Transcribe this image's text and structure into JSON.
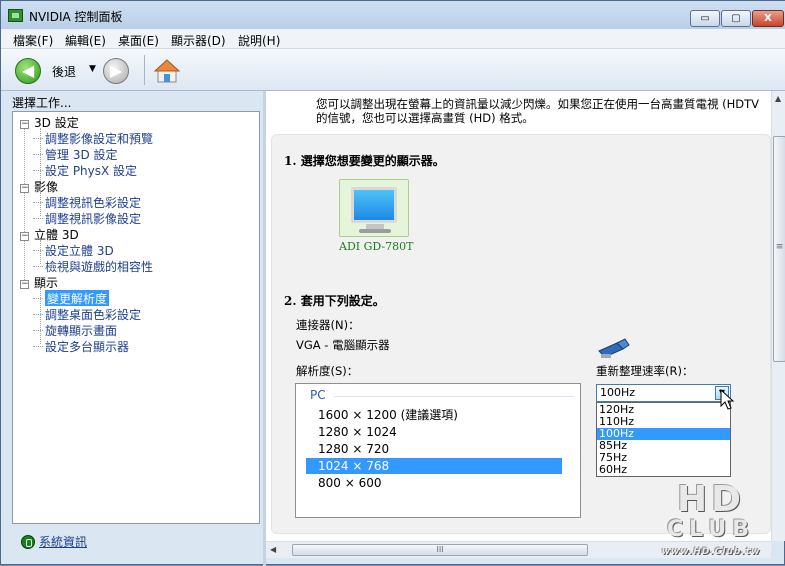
{
  "window": {
    "title": "NVIDIA 控制面板",
    "controls": {
      "minimize": "▭",
      "maximize": "▢",
      "close": "X"
    }
  },
  "menu": [
    "檔案(F)",
    "編輯(E)",
    "桌面(E)",
    "顯示器(D)",
    "說明(H)"
  ],
  "toolbar": {
    "back_label": "後退",
    "back_icon": "back-arrow-icon",
    "forward_icon": "forward-arrow-icon",
    "home_icon": "home-icon"
  },
  "sidebar": {
    "header": "選擇工作...",
    "categories": [
      {
        "label": "3D 設定",
        "items": [
          "調整影像設定和預覽",
          "管理 3D 設定",
          "設定 PhysX 設定"
        ]
      },
      {
        "label": "影像",
        "items": [
          "調整視訊色彩設定",
          "調整視訊影像設定"
        ]
      },
      {
        "label": "立體 3D",
        "items": [
          "設定立體 3D",
          "檢視與遊戲的相容性"
        ]
      },
      {
        "label": "顯示",
        "items": [
          "變更解析度",
          "調整桌面色彩設定",
          "旋轉顯示畫面",
          "設定多台顯示器"
        ]
      }
    ],
    "selected_item": "變更解析度",
    "collapse_glyph": "−",
    "system_info_link": "系統資訊"
  },
  "content": {
    "intro_line1": "您可以調整出現在螢幕上的資訊量以減少閃爍。如果您正在使用一台高畫質電視 (HDTV",
    "intro_line2": "的信號，您也可以選擇高畫質 (HD) 格式。",
    "section1_title": "1. 選擇您想要變更的顯示器。",
    "monitor_name": "ADI GD-780T",
    "section2_title": "2. 套用下列設定。",
    "connector_label": "連接器(N)：",
    "connector_value": "VGA - 電腦顯示器",
    "resolution_label": "解析度(S)：",
    "resolution_group": "PC",
    "resolutions": [
      "1600 × 1200  (建議選項)",
      "1280 × 1024",
      "1280 × 720",
      "1024 × 768",
      "800 × 600"
    ],
    "selected_resolution": "1024 × 768",
    "refresh_label": "重新整理速率(R)：",
    "refresh_value": "100Hz",
    "refresh_options": [
      "120Hz",
      "110Hz",
      "100Hz",
      "85Hz",
      "75Hz",
      "60Hz"
    ],
    "selected_refresh": "100Hz"
  },
  "scrollbars": {
    "vertical_grip": "≡",
    "horizontal_grip": "III"
  },
  "watermark": {
    "big": "HD",
    "club": "CLUB",
    "url": "www.HD.Club.tw"
  },
  "colors": {
    "selection": "#3399ff",
    "link": "#1f3f8f",
    "monitor_label": "#1d7a1d",
    "accent_green": "#2c9a1c"
  }
}
